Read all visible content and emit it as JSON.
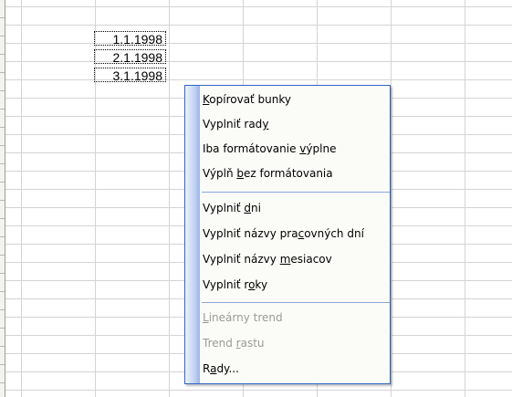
{
  "cells": [
    "1.1.1998",
    "2.1.1998",
    "3.1.1998"
  ],
  "menu": {
    "groups": [
      [
        {
          "pre": "",
          "key": "K",
          "post": "opírovať bunky",
          "disabled": false
        },
        {
          "pre": "Vyplniť rad",
          "key": "y",
          "post": "",
          "disabled": false
        },
        {
          "pre": "Iba formátovanie ",
          "key": "v",
          "post": "ýplne",
          "disabled": false
        },
        {
          "pre": "Výplň ",
          "key": "b",
          "post": "ez formátovania",
          "disabled": false
        }
      ],
      [
        {
          "pre": "Vyplniť ",
          "key": "d",
          "post": "ni",
          "disabled": false
        },
        {
          "pre": "Vyplniť názvy pra",
          "key": "c",
          "post": "ovných dní",
          "disabled": false
        },
        {
          "pre": "Vyplniť názvy ",
          "key": "m",
          "post": "esiacov",
          "disabled": false
        },
        {
          "pre": "Vyplniť r",
          "key": "o",
          "post": "ky",
          "disabled": false
        }
      ],
      [
        {
          "pre": "",
          "key": "L",
          "post": "ineárny trend",
          "disabled": true
        },
        {
          "pre": "Trend ",
          "key": "r",
          "post": "astu",
          "disabled": true
        },
        {
          "pre": "R",
          "key": "a",
          "post": "dy...",
          "disabled": false
        }
      ]
    ]
  }
}
